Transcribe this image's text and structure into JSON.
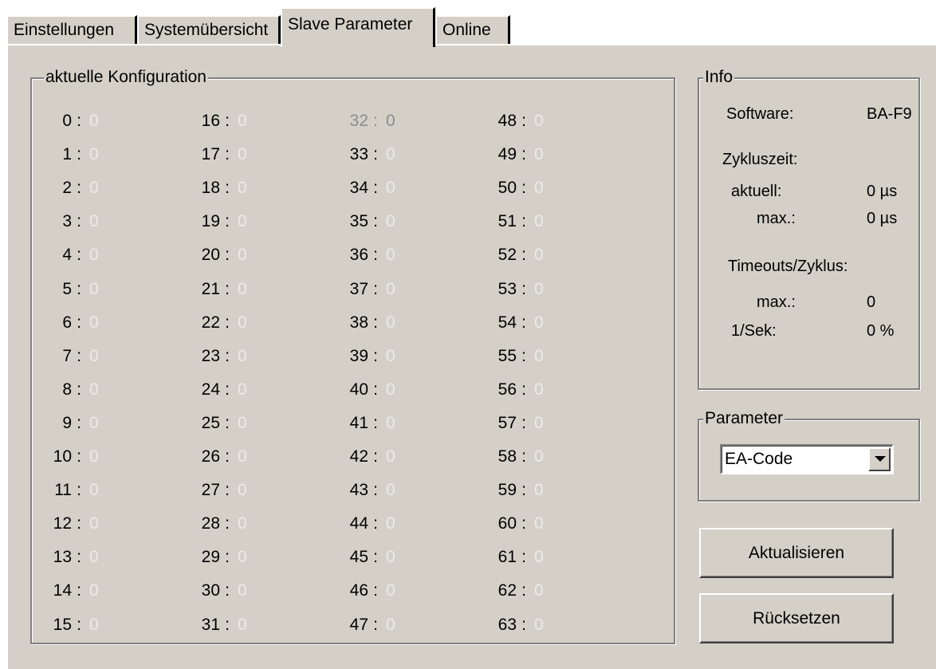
{
  "tabs": [
    {
      "label": "Einstellungen",
      "active": false
    },
    {
      "label": "Systemübersicht",
      "active": false
    },
    {
      "label": "Slave Parameter",
      "active": true
    },
    {
      "label": "Online",
      "active": false
    }
  ],
  "config_group": {
    "legend": "aktuelle Konfiguration",
    "items": [
      {
        "key": "0",
        "value": "0"
      },
      {
        "key": "1",
        "value": "0"
      },
      {
        "key": "2",
        "value": "0"
      },
      {
        "key": "3",
        "value": "0"
      },
      {
        "key": "4",
        "value": "0"
      },
      {
        "key": "5",
        "value": "0"
      },
      {
        "key": "6",
        "value": "0"
      },
      {
        "key": "7",
        "value": "0"
      },
      {
        "key": "8",
        "value": "0"
      },
      {
        "key": "9",
        "value": "0"
      },
      {
        "key": "10",
        "value": "0"
      },
      {
        "key": "11",
        "value": "0"
      },
      {
        "key": "12",
        "value": "0"
      },
      {
        "key": "13",
        "value": "0"
      },
      {
        "key": "14",
        "value": "0"
      },
      {
        "key": "15",
        "value": "0"
      },
      {
        "key": "16",
        "value": "0"
      },
      {
        "key": "17",
        "value": "0"
      },
      {
        "key": "18",
        "value": "0"
      },
      {
        "key": "19",
        "value": "0"
      },
      {
        "key": "20",
        "value": "0"
      },
      {
        "key": "21",
        "value": "0"
      },
      {
        "key": "22",
        "value": "0"
      },
      {
        "key": "23",
        "value": "0"
      },
      {
        "key": "24",
        "value": "0"
      },
      {
        "key": "25",
        "value": "0"
      },
      {
        "key": "26",
        "value": "0"
      },
      {
        "key": "27",
        "value": "0"
      },
      {
        "key": "28",
        "value": "0"
      },
      {
        "key": "29",
        "value": "0"
      },
      {
        "key": "30",
        "value": "0"
      },
      {
        "key": "31",
        "value": "0"
      },
      {
        "key": "32",
        "value": "0",
        "disabled": true
      },
      {
        "key": "33",
        "value": "0"
      },
      {
        "key": "34",
        "value": "0"
      },
      {
        "key": "35",
        "value": "0"
      },
      {
        "key": "36",
        "value": "0"
      },
      {
        "key": "37",
        "value": "0"
      },
      {
        "key": "38",
        "value": "0"
      },
      {
        "key": "39",
        "value": "0"
      },
      {
        "key": "40",
        "value": "0"
      },
      {
        "key": "41",
        "value": "0"
      },
      {
        "key": "42",
        "value": "0"
      },
      {
        "key": "43",
        "value": "0"
      },
      {
        "key": "44",
        "value": "0"
      },
      {
        "key": "45",
        "value": "0"
      },
      {
        "key": "46",
        "value": "0"
      },
      {
        "key": "47",
        "value": "0"
      },
      {
        "key": "48",
        "value": "0"
      },
      {
        "key": "49",
        "value": "0"
      },
      {
        "key": "50",
        "value": "0"
      },
      {
        "key": "51",
        "value": "0"
      },
      {
        "key": "52",
        "value": "0"
      },
      {
        "key": "53",
        "value": "0"
      },
      {
        "key": "54",
        "value": "0"
      },
      {
        "key": "55",
        "value": "0"
      },
      {
        "key": "56",
        "value": "0"
      },
      {
        "key": "57",
        "value": "0"
      },
      {
        "key": "58",
        "value": "0"
      },
      {
        "key": "59",
        "value": "0"
      },
      {
        "key": "60",
        "value": "0"
      },
      {
        "key": "61",
        "value": "0"
      },
      {
        "key": "62",
        "value": "0"
      },
      {
        "key": "63",
        "value": "0"
      }
    ]
  },
  "info": {
    "legend": "Info",
    "software_label": "Software:",
    "software_value": "BA-F9",
    "cycle_label": "Zykluszeit:",
    "current_label": "aktuell:",
    "current_value": "0 µs",
    "max_label": "max.:",
    "max_value": "0 µs",
    "timeouts_label": "Timeouts/Zyklus:",
    "timeouts_max_label": "max.:",
    "timeouts_max_value": "0",
    "per_sec_label": "1/Sek:",
    "per_sec_value": "0 %"
  },
  "parameter": {
    "legend": "Parameter",
    "selected": "EA-Code"
  },
  "buttons": {
    "refresh": "Aktualisieren",
    "reset": "Rücksetzen"
  },
  "colors": {
    "dialog_bg": "#d4d0c8",
    "value_text": "#ecebe6",
    "disabled_text": "#8c8c8c"
  }
}
